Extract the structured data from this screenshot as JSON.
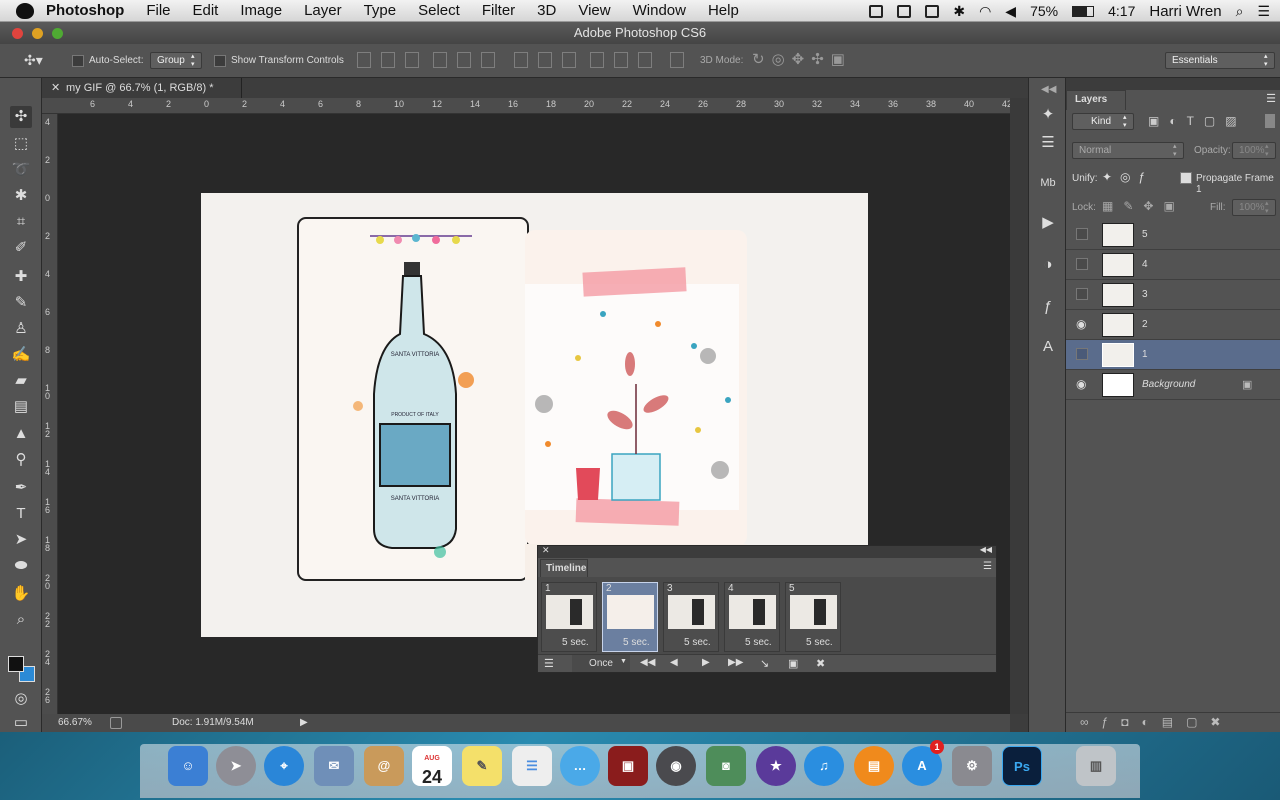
{
  "menubar": {
    "app": "Photoshop",
    "items": [
      "File",
      "Edit",
      "Image",
      "Layer",
      "Type",
      "Select",
      "Filter",
      "3D",
      "View",
      "Window",
      "Help"
    ],
    "battery": "75%",
    "time": "4:17",
    "user": "Harri Wren"
  },
  "window": {
    "title": "Adobe Photoshop CS6"
  },
  "options": {
    "auto_select_label": "Auto-Select:",
    "auto_select_value": "Group",
    "transform_label": "Show Transform Controls",
    "mode_3d": "3D Mode:",
    "workspace": "Essentials"
  },
  "document": {
    "tab": "my GIF @ 66.7% (1, RGB/8) *",
    "ruler_top": [
      "6",
      "4",
      "2",
      "0",
      "2",
      "4",
      "6",
      "8",
      "10",
      "12",
      "14",
      "16",
      "18",
      "20",
      "22",
      "24",
      "26",
      "28",
      "30",
      "32",
      "34",
      "36",
      "38",
      "40",
      "42"
    ],
    "ruler_left": [
      "4",
      "2",
      "0",
      "2",
      "4",
      "6",
      "8",
      "10",
      "12",
      "14",
      "16",
      "18",
      "20",
      "22",
      "24",
      "26"
    ],
    "zoom": "66.67%",
    "doc_size": "Doc: 1.91M/9.54M",
    "artwork": {
      "bottle_text_1": "SANTA VITTORIA",
      "bottle_text_2": "PRODUCT OF ITALY",
      "bottle_text_3": "SANTA VITTORIA"
    }
  },
  "layers": {
    "title": "Layers",
    "kind": "Kind",
    "blend": "Normal",
    "opacity_label": "Opacity:",
    "opacity_value": "100%",
    "unify_label": "Unify:",
    "propagate": "Propagate Frame 1",
    "lock_label": "Lock:",
    "fill_label": "Fill:",
    "fill_value": "100%",
    "rows": [
      {
        "name": "5",
        "visible": false
      },
      {
        "name": "4",
        "visible": false
      },
      {
        "name": "3",
        "visible": false
      },
      {
        "name": "2",
        "visible": true
      },
      {
        "name": "1",
        "visible": false,
        "selected": true
      },
      {
        "name": "Background",
        "visible": true,
        "locked": true
      }
    ]
  },
  "timeline": {
    "title": "Timeline",
    "frames": [
      {
        "num": "1",
        "delay": "5 sec."
      },
      {
        "num": "2",
        "delay": "5 sec.",
        "selected": true
      },
      {
        "num": "3",
        "delay": "5 sec."
      },
      {
        "num": "4",
        "delay": "5 sec."
      },
      {
        "num": "5",
        "delay": "5 sec."
      }
    ],
    "loop": "Once"
  },
  "dock": {
    "calendar_day": "24",
    "calendar_month": "AUG",
    "appstore_badge": "1",
    "ps_label": "Ps"
  },
  "colors": {
    "selection": "#5a6c8c",
    "accent": "#2b8ad6"
  }
}
